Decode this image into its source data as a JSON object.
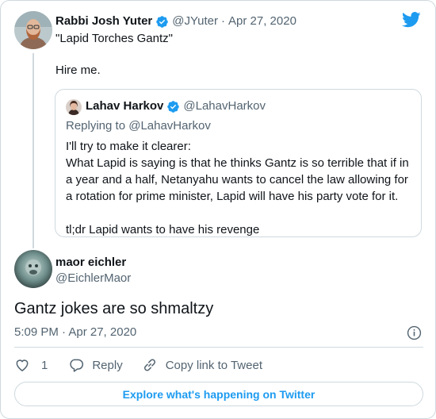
{
  "colors": {
    "accent": "#1d9bf0",
    "text": "#0f1419",
    "secondary_text": "#536471",
    "border": "#cfd9de"
  },
  "parent_tweet": {
    "author_name": "Rabbi Josh Yuter",
    "handle": "@JYuter",
    "separator": "·",
    "date": "Apr 27, 2020",
    "verified_icon": "verified-badge-icon",
    "text": "\"Lapid Torches Gantz\"\n\nHire me."
  },
  "quoted_tweet": {
    "author_name": "Lahav Harkov",
    "handle": "@LahavHarkov",
    "verified_icon": "verified-badge-icon",
    "replying_to": "Replying to @LahavHarkov",
    "text_lines": [
      "I'll try to make it clearer:",
      "What Lapid is saying is that he thinks Gantz is so terrible that if in a year and a half, Netanyahu wants to cancel the law allowing for a rotation for prime minister, Lapid will have his party vote for it.",
      "tl;dr Lapid wants to have his revenge"
    ]
  },
  "main_tweet": {
    "author_name": "maor eichler",
    "handle": "@EichlerMaor",
    "text": "Gantz jokes are so shmaltzy",
    "timestamp": "5:09 PM · Apr 27, 2020"
  },
  "actions": {
    "like_count": "1",
    "reply_label": "Reply",
    "copy_link_label": "Copy link to Tweet"
  },
  "footer": {
    "explore_label": "Explore what's happening on Twitter"
  },
  "icons": {
    "brand": "twitter-bird-icon",
    "info": "info-icon",
    "like": "heart-icon",
    "reply": "speech-bubble-icon",
    "copy_link": "link-icon"
  }
}
